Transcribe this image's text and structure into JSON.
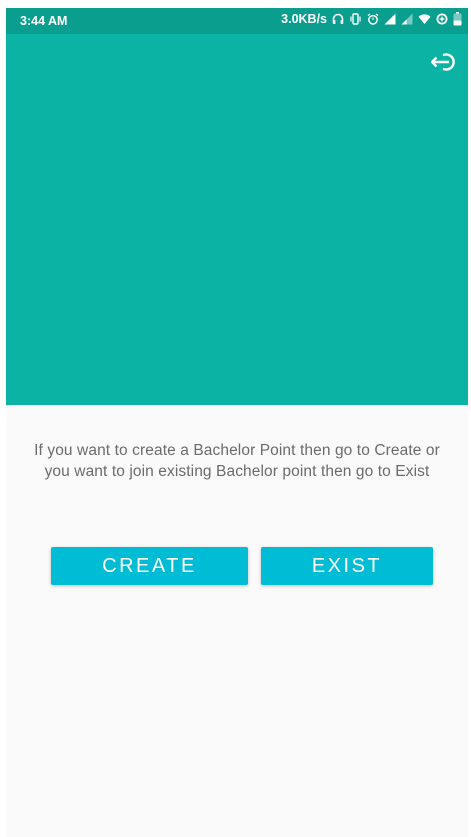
{
  "status_bar": {
    "time": "3:44 AM",
    "network_speed": "3.0KB/s",
    "battery_level": "30",
    "icons": [
      "headphones-icon",
      "vibrate-icon",
      "alarm-icon",
      "signal-icon",
      "signal-weak-icon",
      "wifi-icon",
      "data-saver-icon",
      "battery-icon"
    ]
  },
  "header": {
    "color": "#0bb3a4",
    "action_icon": "logout-icon"
  },
  "main": {
    "message": "If you want to create a Bachelor Point then go to Create or you want to join existing Bachelor point then go to Exist",
    "create_label": "CREATE",
    "exist_label": "EXIST",
    "button_color": "#00bcd4"
  }
}
